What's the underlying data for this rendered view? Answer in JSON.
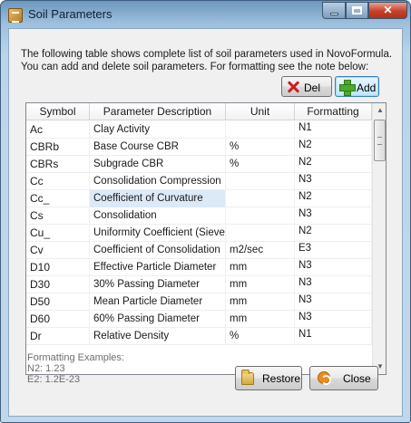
{
  "window": {
    "title": "Soil Parameters"
  },
  "intro": {
    "text": "The following table shows complete list of soil parameters used in NovoFormula. You can add and delete soil parameters. For formatting see the note below:"
  },
  "toolbar": {
    "delete_label": "Del",
    "add_label": "Add"
  },
  "table": {
    "columns": [
      "Symbol",
      "Parameter Description",
      "Unit",
      "Formatting"
    ],
    "rows": [
      {
        "symbol": "Ac",
        "description": "Clay Activity",
        "unit": "",
        "formatting": "N1"
      },
      {
        "symbol": "CBRb",
        "description": "Base Course CBR",
        "unit": "%",
        "formatting": "N2"
      },
      {
        "symbol": "CBRs",
        "description": "Subgrade CBR",
        "unit": "%",
        "formatting": "N2"
      },
      {
        "symbol": "Cc",
        "description": "Consolidation Compression",
        "unit": "",
        "formatting": "N3"
      },
      {
        "symbol": "Cc_",
        "description": "Coefficient of Curvature",
        "unit": "",
        "formatting": "N2"
      },
      {
        "symbol": "Cs",
        "description": "Consolidation",
        "unit": "",
        "formatting": "N3"
      },
      {
        "symbol": "Cu_",
        "description": "Uniformity Coefficient (Sieve",
        "unit": "",
        "formatting": "N2"
      },
      {
        "symbol": "Cv",
        "description": "Coefficient of Consolidation",
        "unit": "m2/sec",
        "formatting": "E3"
      },
      {
        "symbol": "D10",
        "description": "Effective Particle Diameter",
        "unit": "mm",
        "formatting": "N3"
      },
      {
        "symbol": "D30",
        "description": "30% Passing Diameter",
        "unit": "mm",
        "formatting": "N3"
      },
      {
        "symbol": "D50",
        "description": "Mean Particle Diameter",
        "unit": "mm",
        "formatting": "N3"
      },
      {
        "symbol": "D60",
        "description": "60% Passing Diameter",
        "unit": "mm",
        "formatting": "N3"
      },
      {
        "symbol": "Dr",
        "description": "Relative Density",
        "unit": "%",
        "formatting": "N1"
      }
    ]
  },
  "formatting_note": {
    "title": "Formatting Examples:",
    "example1": "N2: 1.23",
    "example2": "E2: 1.2E-23"
  },
  "footer": {
    "restore_label": "Restore",
    "close_label": "Close"
  }
}
